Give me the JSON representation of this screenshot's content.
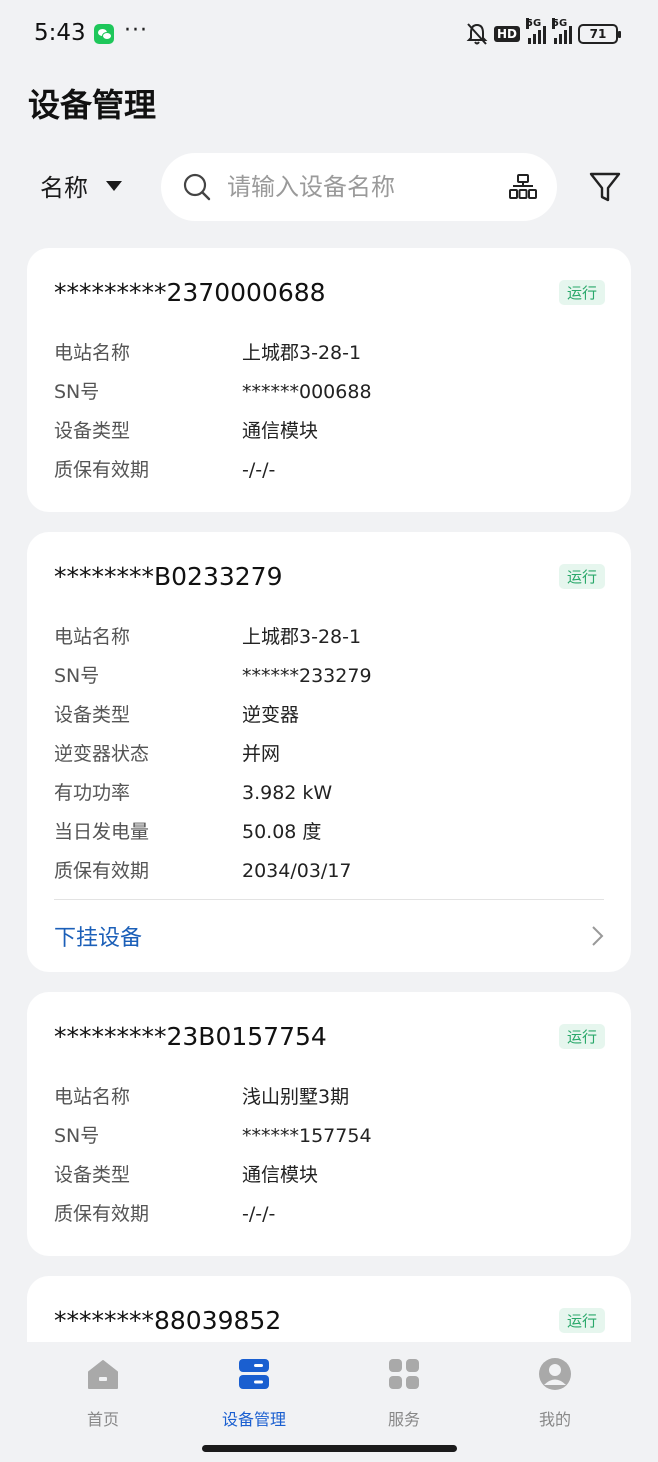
{
  "status_bar": {
    "time": "5:43",
    "dots": "···",
    "battery": "71",
    "net": "5G"
  },
  "page_title": "设备管理",
  "filter": {
    "field_label": "名称",
    "search_placeholder": "请输入设备名称"
  },
  "devices": [
    {
      "title": "*********2370000688",
      "status": "运行",
      "fields": [
        {
          "k": "电站名称",
          "v": "上城郡3-28-1"
        },
        {
          "k": "SN号",
          "v": "******000688"
        },
        {
          "k": "设备类型",
          "v": "通信模块"
        },
        {
          "k": "质保有效期",
          "v": "-/-/-"
        }
      ]
    },
    {
      "title": "********B0233279",
      "status": "运行",
      "fields": [
        {
          "k": "电站名称",
          "v": "上城郡3-28-1"
        },
        {
          "k": "SN号",
          "v": "******233279"
        },
        {
          "k": "设备类型",
          "v": "逆变器"
        },
        {
          "k": "逆变器状态",
          "v": "并网"
        },
        {
          "k": "有功功率",
          "v": "3.982 kW"
        },
        {
          "k": "当日发电量",
          "v": "50.08 度"
        },
        {
          "k": "质保有效期",
          "v": "2034/03/17"
        }
      ],
      "sub_devices_label": "下挂设备"
    },
    {
      "title": "*********23B0157754",
      "status": "运行",
      "fields": [
        {
          "k": "电站名称",
          "v": "浅山别墅3期"
        },
        {
          "k": "SN号",
          "v": "******157754"
        },
        {
          "k": "设备类型",
          "v": "通信模块"
        },
        {
          "k": "质保有效期",
          "v": "-/-/-"
        }
      ]
    },
    {
      "title": "********88039852",
      "status": "运行",
      "fields": []
    }
  ],
  "tabs": [
    {
      "label": "首页",
      "icon": "home-icon",
      "active": false
    },
    {
      "label": "设备管理",
      "icon": "device-icon",
      "active": true
    },
    {
      "label": "服务",
      "icon": "service-icon",
      "active": false
    },
    {
      "label": "我的",
      "icon": "profile-icon",
      "active": false
    }
  ],
  "colors": {
    "accent": "#1a5fd0",
    "status_green": "#29a86a",
    "link": "#1b5fb8"
  }
}
